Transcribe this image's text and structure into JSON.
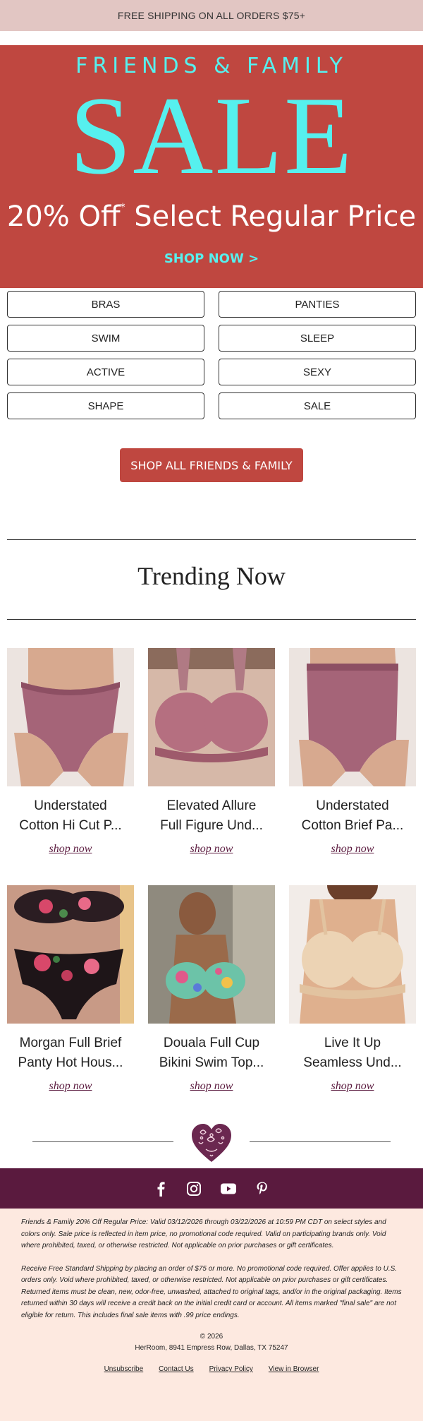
{
  "announcement": "FREE SHIPPING ON ALL ORDERS $75+",
  "hero": {
    "kicker": "FRIENDS & FAMILY",
    "headline": "SALE",
    "offer": "20% Off",
    "offer_mark": "*",
    "offer_rest": "Select Regular Price",
    "cta": "SHOP NOW >",
    "bg_color": "#bf4740",
    "accent_color": "#56f0ee"
  },
  "categories": [
    "BRAS",
    "PANTIES",
    "SWIM",
    "SLEEP",
    "ACTIVE",
    "SEXY",
    "SHAPE",
    "SALE"
  ],
  "shop_all": "SHOP ALL FRIENDS & FAMILY",
  "trending_title": "Trending Now",
  "products": [
    {
      "line1": "Understated",
      "line2": "Cotton Hi Cut P...",
      "cta": "shop now",
      "image": "mauve-hi-cut-panty"
    },
    {
      "line1": "Elevated Allure",
      "line2": "Full Figure Und...",
      "cta": "shop now",
      "image": "mauve-underwire-bra"
    },
    {
      "line1": "Understated",
      "line2": "Cotton Brief Pa...",
      "cta": "shop now",
      "image": "mauve-brief-panty"
    },
    {
      "line1": "Morgan Full Brief",
      "line2": "Panty Hot Hous...",
      "cta": "shop now",
      "image": "floral-black-lace-brief"
    },
    {
      "line1": "Douala Full Cup",
      "line2": "Bikini Swim Top...",
      "cta": "shop now",
      "image": "tropical-print-swim-top"
    },
    {
      "line1": "Live It Up",
      "line2": "Seamless Und...",
      "cta": "shop now",
      "image": "nude-seamless-bra"
    }
  ],
  "social": [
    "facebook-icon",
    "instagram-icon",
    "youtube-icon",
    "pinterest-icon"
  ],
  "footer": {
    "legal1": "Friends & Family 20% Off Regular Price: Valid 03/12/2026 through 03/22/2026 at 10:59 PM CDT on select styles and colors only. Sale price is reflected in item price, no promotional code required. Valid on participating brands only. Void where prohibited, taxed, or otherwise restricted. Not applicable on prior purchases or gift certificates.",
    "legal2": "Receive Free Standard Shipping by placing an order of $75 or more. No promotional code required. Offer applies to U.S. orders only. Void where prohibited, taxed, or otherwise restricted. Not applicable on prior purchases or gift certificates. Returned items must be clean, new, odor-free, unwashed, attached to original tags, and/or in the original packaging. Items returned within 30 days will receive a credit back on the initial credit card or account. All items marked \"final sale\" are not eligible for return. This includes final sale items with .99 price endings.",
    "copyright": "© 2026",
    "address": "HerRoom, 8941 Empress Row, Dallas, TX 75247",
    "links": [
      "Unsubscribe",
      "Contact Us",
      "Privacy Policy",
      "View in Browser"
    ]
  }
}
